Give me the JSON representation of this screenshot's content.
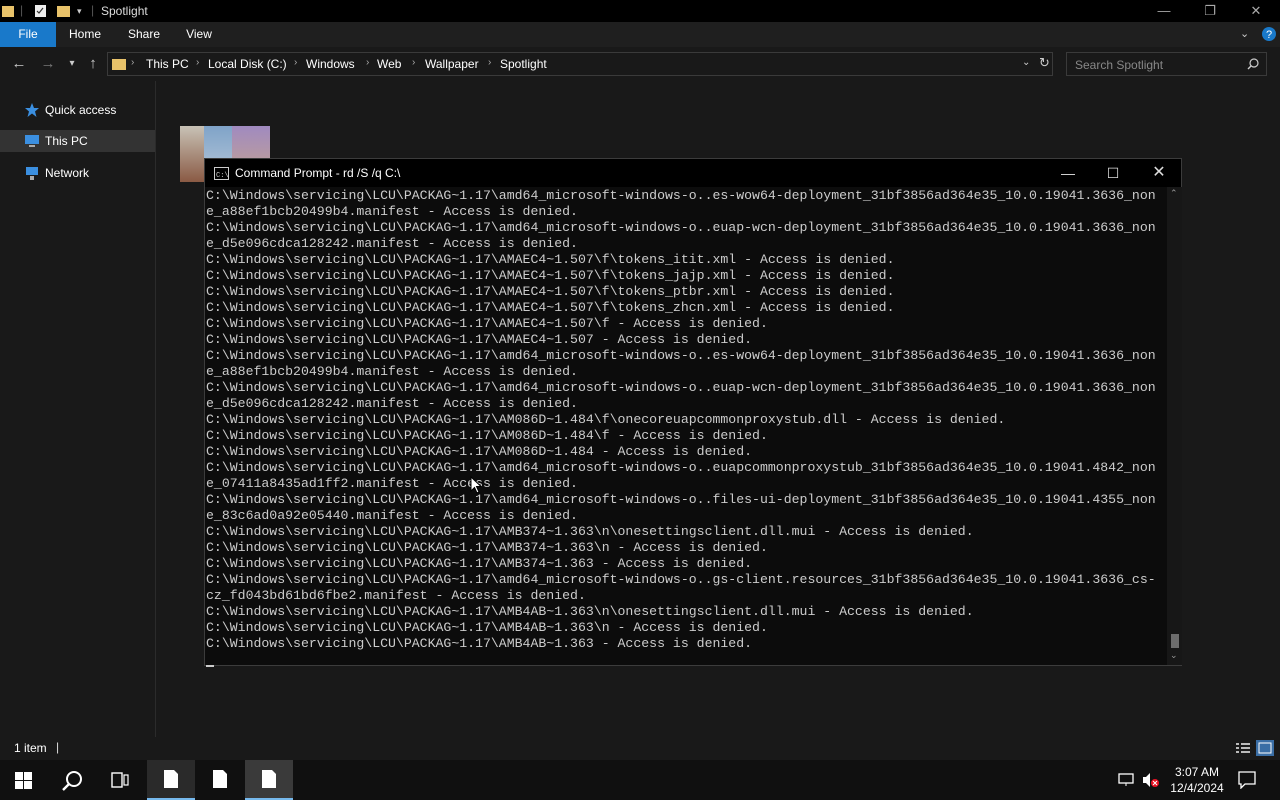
{
  "window": {
    "title": "Spotlight"
  },
  "ribbon": {
    "tabs": [
      "File",
      "Home",
      "Share",
      "View"
    ]
  },
  "address": {
    "crumbs": [
      "This PC",
      "Local Disk (C:)",
      "Windows",
      "Web",
      "Wallpaper",
      "Spotlight"
    ]
  },
  "search": {
    "placeholder": "Search Spotlight"
  },
  "sidebar": {
    "items": [
      {
        "label": "Quick access",
        "icon": "star-icon"
      },
      {
        "label": "This PC",
        "icon": "computer-icon",
        "selected": true
      },
      {
        "label": "Network",
        "icon": "network-icon"
      }
    ]
  },
  "status": {
    "item_count": "1 item"
  },
  "taskbar": {
    "time": "3:07 AM",
    "date": "12/4/2024"
  },
  "cmd": {
    "title": "Command Prompt - rd  /S /q C:\\",
    "lines": [
      "C:\\Windows\\servicing\\LCU\\PACKAG~1.17\\amd64_microsoft-windows-o..es-wow64-deployment_31bf3856ad364e35_10.0.19041.3636_non",
      "e_a88ef1bcb20499b4.manifest - Access is denied.",
      "C:\\Windows\\servicing\\LCU\\PACKAG~1.17\\amd64_microsoft-windows-o..euap-wcn-deployment_31bf3856ad364e35_10.0.19041.3636_non",
      "e_d5e096cdca128242.manifest - Access is denied.",
      "C:\\Windows\\servicing\\LCU\\PACKAG~1.17\\AMAEC4~1.507\\f\\tokens_itit.xml - Access is denied.",
      "C:\\Windows\\servicing\\LCU\\PACKAG~1.17\\AMAEC4~1.507\\f\\tokens_jajp.xml - Access is denied.",
      "C:\\Windows\\servicing\\LCU\\PACKAG~1.17\\AMAEC4~1.507\\f\\tokens_ptbr.xml - Access is denied.",
      "C:\\Windows\\servicing\\LCU\\PACKAG~1.17\\AMAEC4~1.507\\f\\tokens_zhcn.xml - Access is denied.",
      "C:\\Windows\\servicing\\LCU\\PACKAG~1.17\\AMAEC4~1.507\\f - Access is denied.",
      "C:\\Windows\\servicing\\LCU\\PACKAG~1.17\\AMAEC4~1.507 - Access is denied.",
      "C:\\Windows\\servicing\\LCU\\PACKAG~1.17\\amd64_microsoft-windows-o..es-wow64-deployment_31bf3856ad364e35_10.0.19041.3636_non",
      "e_a88ef1bcb20499b4.manifest - Access is denied.",
      "C:\\Windows\\servicing\\LCU\\PACKAG~1.17\\amd64_microsoft-windows-o..euap-wcn-deployment_31bf3856ad364e35_10.0.19041.3636_non",
      "e_d5e096cdca128242.manifest - Access is denied.",
      "C:\\Windows\\servicing\\LCU\\PACKAG~1.17\\AM086D~1.484\\f\\onecoreuapcommonproxystub.dll - Access is denied.",
      "C:\\Windows\\servicing\\LCU\\PACKAG~1.17\\AM086D~1.484\\f - Access is denied.",
      "C:\\Windows\\servicing\\LCU\\PACKAG~1.17\\AM086D~1.484 - Access is denied.",
      "C:\\Windows\\servicing\\LCU\\PACKAG~1.17\\amd64_microsoft-windows-o..euapcommonproxystub_31bf3856ad364e35_10.0.19041.4842_non",
      "e_07411a8435ad1ff2.manifest - Access is denied.",
      "C:\\Windows\\servicing\\LCU\\PACKAG~1.17\\amd64_microsoft-windows-o..files-ui-deployment_31bf3856ad364e35_10.0.19041.4355_non",
      "e_83c6ad0a92e05440.manifest - Access is denied.",
      "C:\\Windows\\servicing\\LCU\\PACKAG~1.17\\AMB374~1.363\\n\\onesettingsclient.dll.mui - Access is denied.",
      "C:\\Windows\\servicing\\LCU\\PACKAG~1.17\\AMB374~1.363\\n - Access is denied.",
      "C:\\Windows\\servicing\\LCU\\PACKAG~1.17\\AMB374~1.363 - Access is denied.",
      "C:\\Windows\\servicing\\LCU\\PACKAG~1.17\\amd64_microsoft-windows-o..gs-client.resources_31bf3856ad364e35_10.0.19041.3636_cs-",
      "cz_fd043bd61bd6fbe2.manifest - Access is denied.",
      "C:\\Windows\\servicing\\LCU\\PACKAG~1.17\\AMB4AB~1.363\\n\\onesettingsclient.dll.mui - Access is denied.",
      "C:\\Windows\\servicing\\LCU\\PACKAG~1.17\\AMB4AB~1.363\\n - Access is denied.",
      "C:\\Windows\\servicing\\LCU\\PACKAG~1.17\\AMB4AB~1.363 - Access is denied."
    ]
  }
}
